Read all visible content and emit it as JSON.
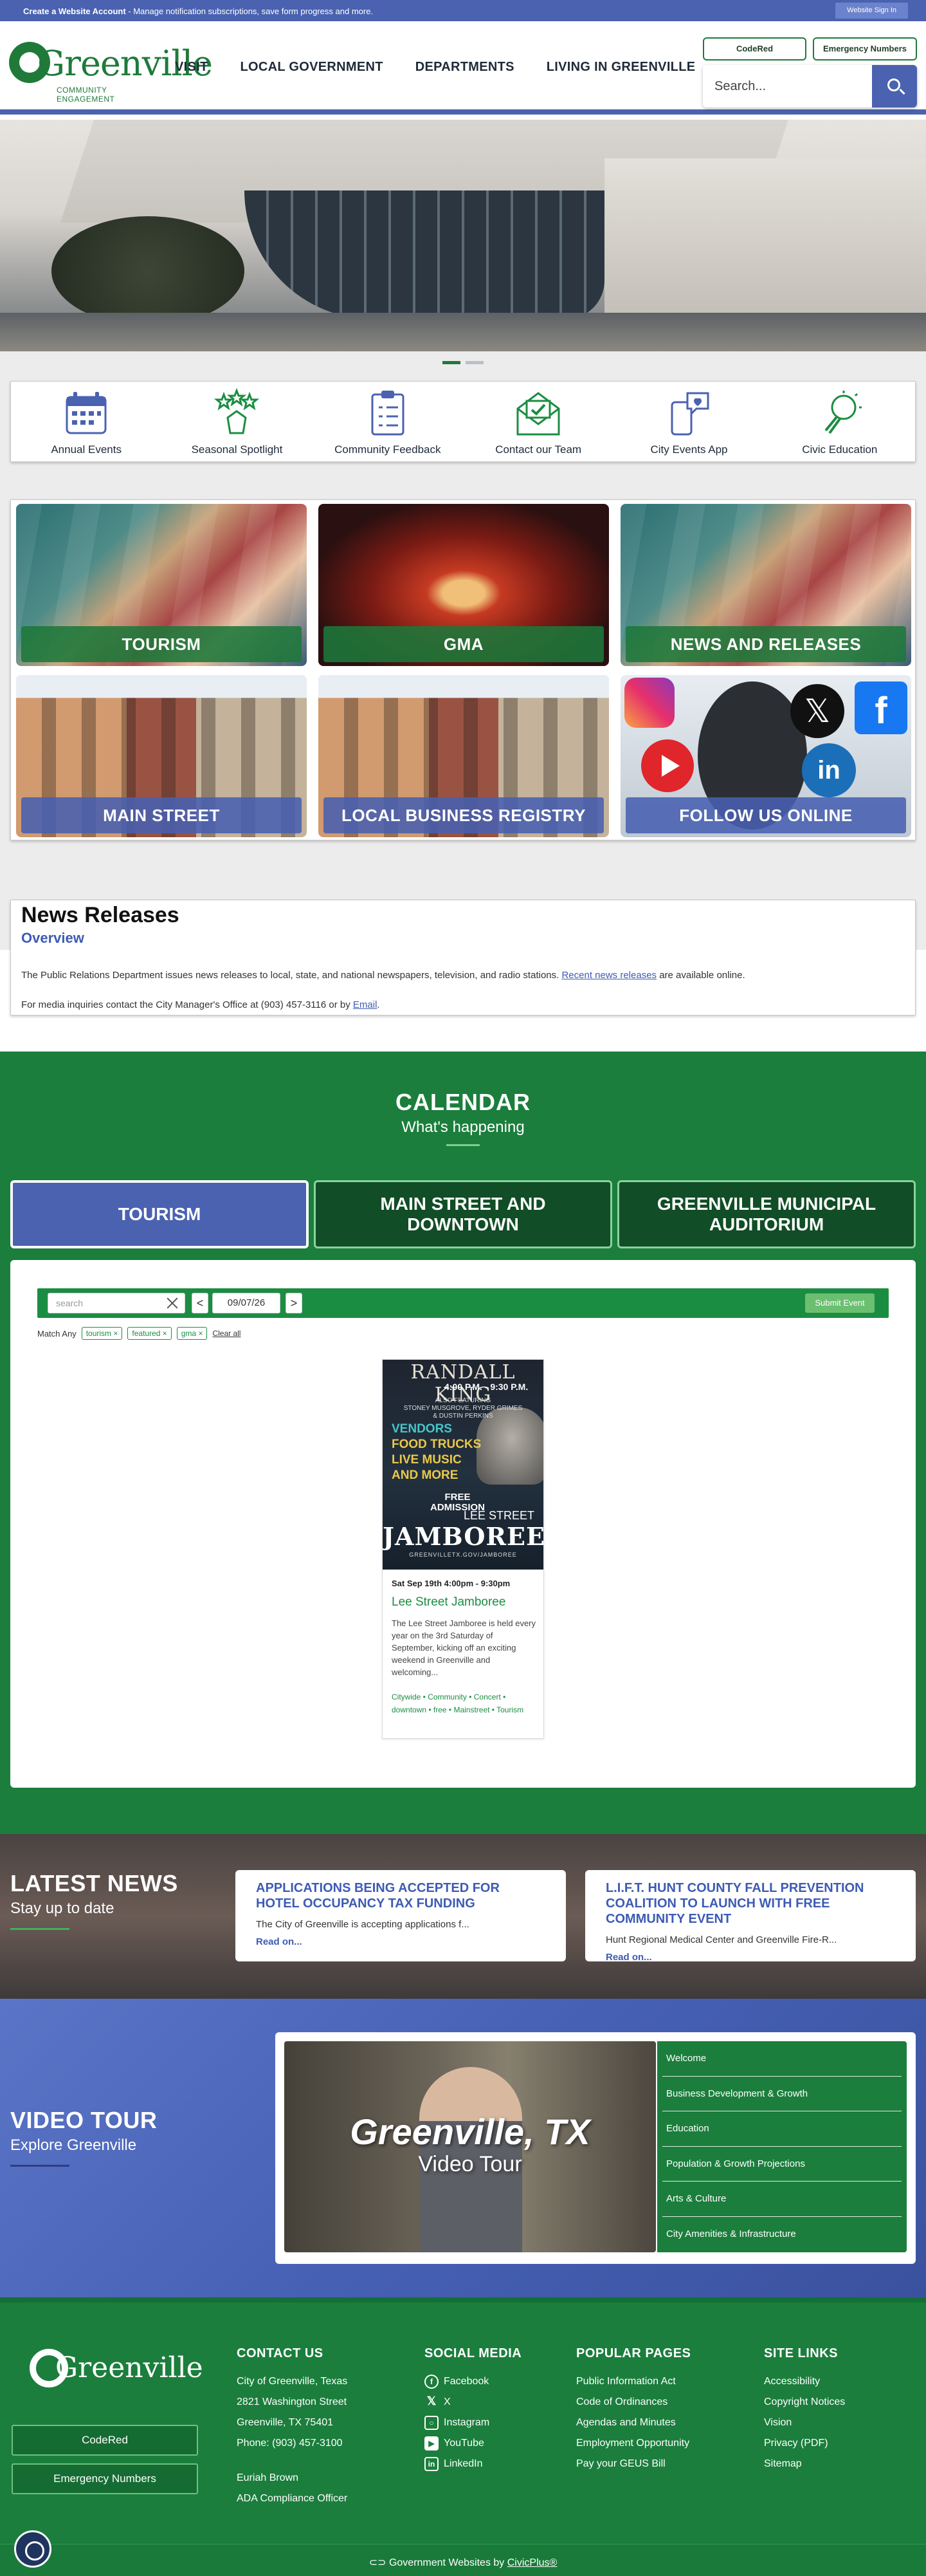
{
  "topbar": {
    "strong": "Create a Website Account",
    "message": " - Manage notification subscriptions, save form progress and more.",
    "signin": "Website Sign In"
  },
  "header": {
    "logo_word": "Greenville",
    "logo_sub": "COMMUNITY ENGAGEMENT",
    "nav": [
      "VISIT",
      "LOCAL GOVERNMENT",
      "DEPARTMENTS",
      "LIVING IN GREENVILLE"
    ],
    "codered": "CodeRed",
    "emergency": "Emergency Numbers",
    "search_placeholder": "Search..."
  },
  "quicklinks": [
    {
      "label": "Annual Events",
      "icon": "calendar-icon"
    },
    {
      "label": "Seasonal Spotlight",
      "icon": "stars-hand-icon"
    },
    {
      "label": "Community Feedback",
      "icon": "clipboard-icon"
    },
    {
      "label": "Contact our Team",
      "icon": "envelope-icon"
    },
    {
      "label": "City Events App",
      "icon": "phone-chat-icon"
    },
    {
      "label": "Civic Education",
      "icon": "lightbulb-icon"
    }
  ],
  "tiles": [
    "TOURISM",
    "GMA",
    "NEWS AND RELEASES",
    "MAIN STREET",
    "LOCAL BUSINESS REGISTRY",
    "FOLLOW US ONLINE"
  ],
  "poster": {
    "t1": "RANDALL KING",
    "t2": "4:00 P.M. - 9:30 P.M.",
    "t3": "ALSO FEATURING\nSTONEY MUSGROVE, RYDER GRIMES\n& DUSTIN PERKINS",
    "l1": "VENDORS",
    "l2": "FOOD TRUCKS",
    "l3": "LIVE MUSIC",
    "l4": "AND MORE",
    "t5": "FREE\nADMISSION",
    "t6": "LEE STREET",
    "t7": "JAMBOREE",
    "t8": "GREENVILLETX.GOV/JAMBOREE"
  },
  "news_releases": {
    "title": "News Releases",
    "subtitle": "Overview",
    "p1_a": "The Public Relations Department issues news releases to local, state, and national newspapers, television, and radio stations. ",
    "p1_link": "Recent news releases",
    "p1_b": " are available online.",
    "p2_a": "For media inquiries contact the City Manager's Office at (903) 457-3116 or by ",
    "p2_link": "Email",
    "p2_b": "."
  },
  "calendar": {
    "title": "CALENDAR",
    "subtitle": "What's happening",
    "tabs": [
      "TOURISM",
      "MAIN STREET AND DOWNTOWN",
      "GREENVILLE MUNICIPAL AUDITORIUM"
    ],
    "search_placeholder": "search",
    "prev": "<",
    "next": ">",
    "date": "09/07/26",
    "submit": "Submit Event",
    "match": "Match Any",
    "chips": [
      "tourism ×",
      "featured ×",
      "gma ×"
    ],
    "clear": "Clear all",
    "event": {
      "when": "Sat Sep 19th 4:00pm - 9:30pm",
      "name": "Lee Street Jamboree",
      "desc": "The Lee Street Jamboree is held every year on the 3rd Saturday of September, kicking off an exciting weekend in Greenville and welcoming...",
      "tags": "Citywide • Community • Concert • downtown • free • Mainstreet • Tourism"
    }
  },
  "latest_news": {
    "title": "LATEST NEWS",
    "subtitle": "Stay up to date",
    "cards": [
      {
        "title": "APPLICATIONS BEING ACCEPTED FOR HOTEL OCCUPANCY TAX FUNDING",
        "body": "The City of Greenville is accepting applications f...",
        "more": "Read on..."
      },
      {
        "title": "L.I.F.T. Hunt County Fall Prevention Coalition to Launch with Free Community Event",
        "body": "Hunt Regional Medical Center and Greenville Fire-R...",
        "more": "Read on..."
      }
    ]
  },
  "video": {
    "title": "VIDEO TOUR",
    "subtitle": "Explore Greenville",
    "overlay1": "Greenville, TX",
    "overlay2": "Video Tour",
    "chapters": [
      "Welcome",
      "Business Development & Growth",
      "Education",
      "Population & Growth Projections",
      "Arts & Culture",
      "City Amenities & Infrastructure"
    ]
  },
  "footer": {
    "logo_word": "Greenville",
    "codered": "CodeRed",
    "emergency": "Emergency Numbers",
    "contact": {
      "heading": "CONTACT US",
      "lines": [
        "City of Greenville, Texas",
        "2821 Washington Street",
        "Greenville, TX 75401",
        "Phone: (903) 457-3100"
      ],
      "extra": [
        "Euriah Brown",
        "ADA Compliance Officer"
      ]
    },
    "social": {
      "heading": "SOCIAL MEDIA",
      "items": [
        "Facebook",
        "X",
        "Instagram",
        "YouTube",
        "LinkedIn"
      ]
    },
    "popular": {
      "heading": "POPULAR PAGES",
      "items": [
        "Public Information Act",
        "Code of Ordinances",
        "Agendas and Minutes",
        "Employment Opportunity",
        "Pay your GEUS Bill"
      ]
    },
    "site": {
      "heading": "SITE LINKS",
      "items": [
        "Accessibility",
        "Copyright Notices",
        "Vision",
        "Privacy (PDF)",
        "Sitemap"
      ]
    },
    "bottom_a": "Government Websites by ",
    "bottom_link": "CivicPlus®"
  },
  "colors": {
    "brand_green": "#1b7e3c",
    "brand_blue": "#4a62b0",
    "link_blue": "#3d5bb4"
  }
}
